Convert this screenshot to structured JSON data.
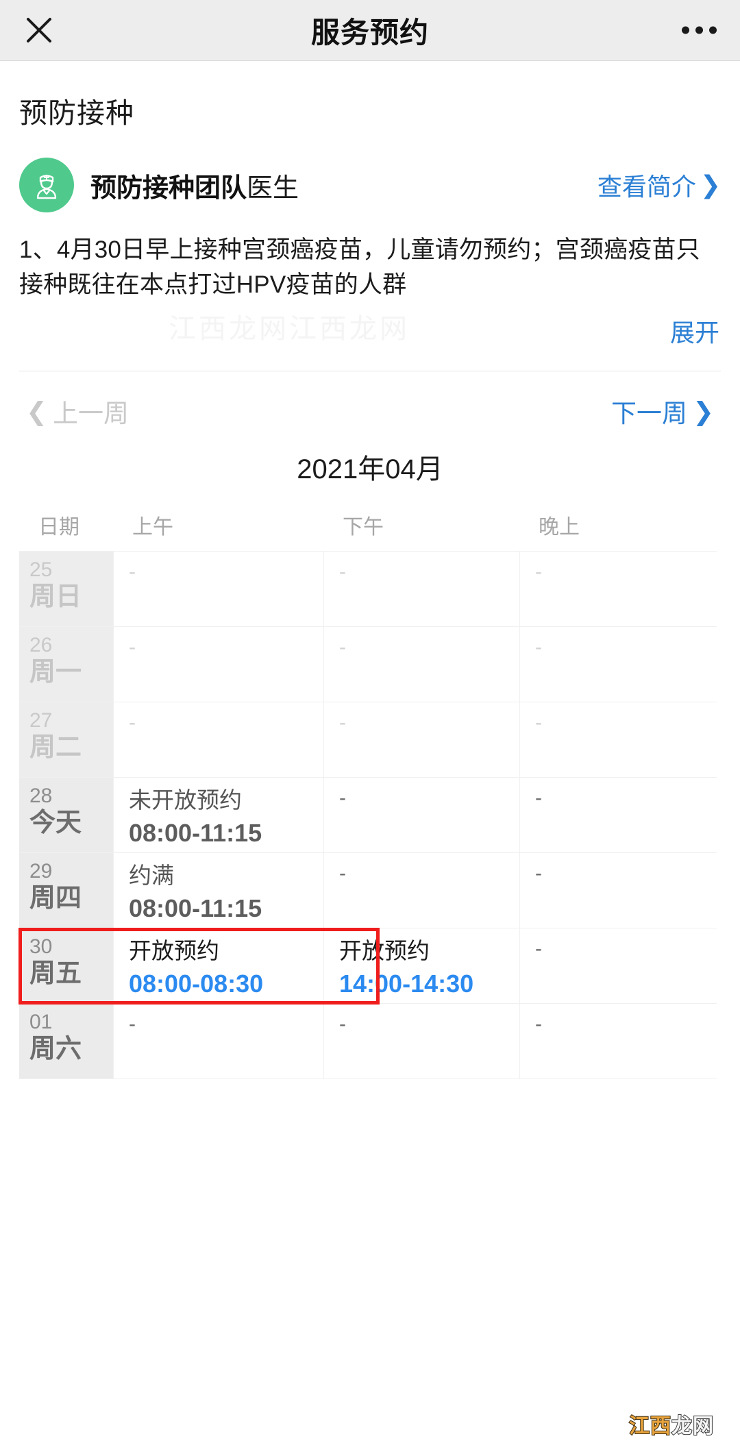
{
  "navbar": {
    "close_icon": "close-icon",
    "title": "服务预约",
    "more_icon": "more-options-icon"
  },
  "service": {
    "section_title": "预防接种",
    "doctor": {
      "avatar_icon": "doctor-avatar-icon",
      "team_name": "预防接种团队",
      "role": "医生",
      "avatar_color": "#4fc98c"
    },
    "profile_link": {
      "label": "查看简介",
      "chevron": "❯",
      "color": "#2b7fd4"
    },
    "notice": "1、4月30日早上接种宫颈癌疫苗，儿童请勿预约；宫颈癌疫苗只接种既往在本点打过HPV疫苗的人群",
    "ghost_text": "江西龙网江西龙网",
    "expand_label": "展开"
  },
  "week_nav": {
    "prev_label": "上一周",
    "prev_chevron": "❮",
    "prev_disabled": true,
    "next_label": "下一周",
    "next_chevron": "❯",
    "next_color": "#2b7fd4",
    "month_title": "2021年04月"
  },
  "calendar": {
    "headers": {
      "date": "日期",
      "am": "上午",
      "pm": "下午",
      "evening": "晚上"
    },
    "empty_mark": "-",
    "highlight_color": "#f01d1d",
    "rows": [
      {
        "day_num": "25",
        "weekday": "周日",
        "past": true,
        "am": {
          "status": "",
          "time": "",
          "empty": "-",
          "state": "none"
        },
        "pm": {
          "status": "",
          "time": "",
          "empty": "-",
          "state": "none"
        },
        "evening": {
          "status": "",
          "time": "",
          "empty": "-",
          "state": "none"
        }
      },
      {
        "day_num": "26",
        "weekday": "周一",
        "past": true,
        "am": {
          "status": "",
          "time": "",
          "empty": "-",
          "state": "none"
        },
        "pm": {
          "status": "",
          "time": "",
          "empty": "-",
          "state": "none"
        },
        "evening": {
          "status": "",
          "time": "",
          "empty": "-",
          "state": "none"
        }
      },
      {
        "day_num": "27",
        "weekday": "周二",
        "past": true,
        "am": {
          "status": "",
          "time": "",
          "empty": "-",
          "state": "none"
        },
        "pm": {
          "status": "",
          "time": "",
          "empty": "-",
          "state": "none"
        },
        "evening": {
          "status": "",
          "time": "",
          "empty": "-",
          "state": "none"
        }
      },
      {
        "day_num": "28",
        "weekday": "今天",
        "past": false,
        "am": {
          "status": "未开放预约",
          "time": "08:00-11:15",
          "empty": "",
          "state": "closed"
        },
        "pm": {
          "status": "",
          "time": "",
          "empty": "-",
          "state": "none"
        },
        "evening": {
          "status": "",
          "time": "",
          "empty": "-",
          "state": "none"
        }
      },
      {
        "day_num": "29",
        "weekday": "周四",
        "past": false,
        "am": {
          "status": "约满",
          "time": "08:00-11:15",
          "empty": "",
          "state": "full"
        },
        "pm": {
          "status": "",
          "time": "",
          "empty": "-",
          "state": "none"
        },
        "evening": {
          "status": "",
          "time": "",
          "empty": "-",
          "state": "none"
        }
      },
      {
        "day_num": "30",
        "weekday": "周五",
        "past": false,
        "highlighted": true,
        "am": {
          "status": "开放预约",
          "time": "08:00-08:30",
          "empty": "",
          "state": "open"
        },
        "pm": {
          "status": "开放预约",
          "time": "14:00-14:30",
          "empty": "",
          "state": "open"
        },
        "evening": {
          "status": "",
          "time": "",
          "empty": "-",
          "state": "none"
        }
      },
      {
        "day_num": "01",
        "weekday": "周六",
        "past": false,
        "am": {
          "status": "",
          "time": "",
          "empty": "-",
          "state": "none"
        },
        "pm": {
          "status": "",
          "time": "",
          "empty": "-",
          "state": "none"
        },
        "evening": {
          "status": "",
          "time": "",
          "empty": "-",
          "state": "none"
        }
      }
    ]
  },
  "watermark": {
    "part1": "江西",
    "part2": "龙网"
  }
}
